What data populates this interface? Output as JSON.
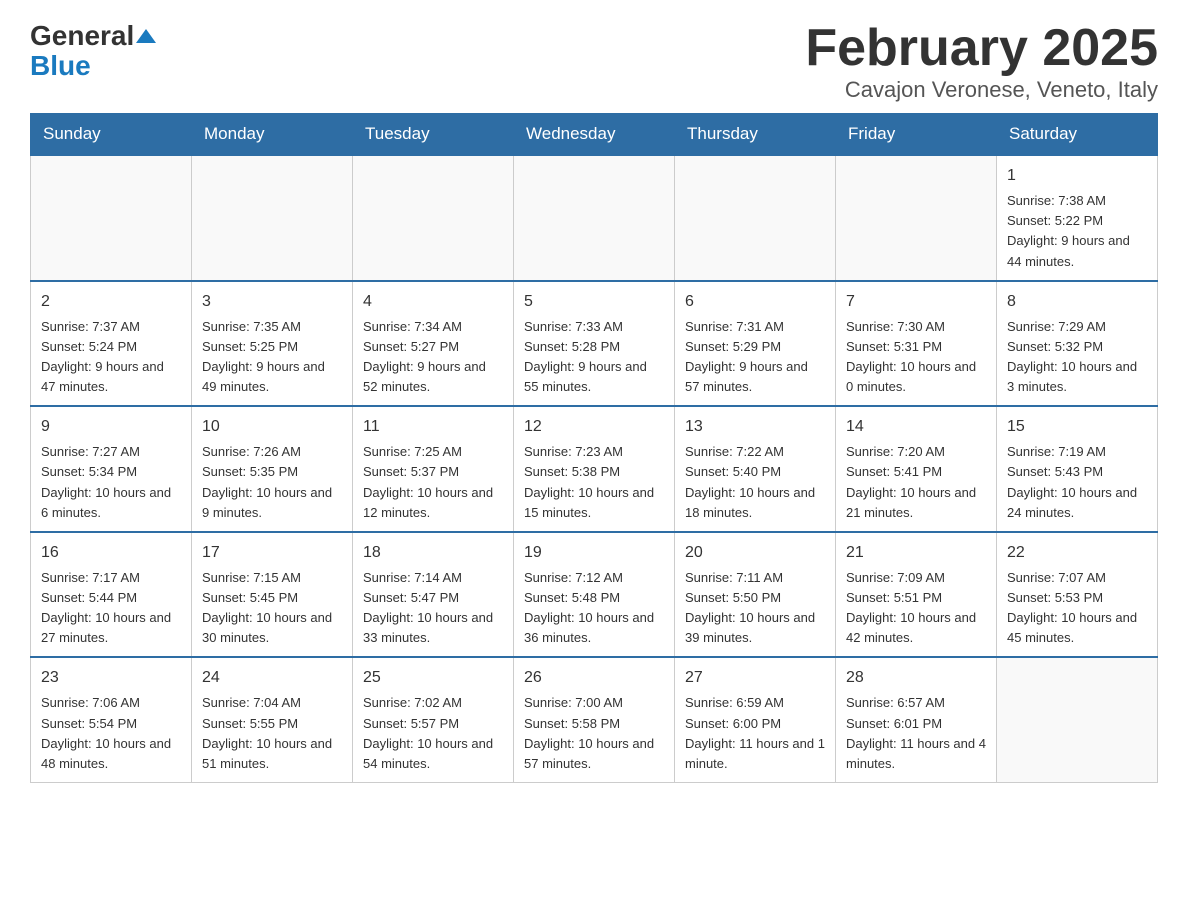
{
  "header": {
    "logo_general": "General",
    "logo_blue": "Blue",
    "month_title": "February 2025",
    "subtitle": "Cavajon Veronese, Veneto, Italy"
  },
  "days_of_week": [
    "Sunday",
    "Monday",
    "Tuesday",
    "Wednesday",
    "Thursday",
    "Friday",
    "Saturday"
  ],
  "weeks": [
    [
      {
        "day": "",
        "info": ""
      },
      {
        "day": "",
        "info": ""
      },
      {
        "day": "",
        "info": ""
      },
      {
        "day": "",
        "info": ""
      },
      {
        "day": "",
        "info": ""
      },
      {
        "day": "",
        "info": ""
      },
      {
        "day": "1",
        "info": "Sunrise: 7:38 AM\nSunset: 5:22 PM\nDaylight: 9 hours and 44 minutes."
      }
    ],
    [
      {
        "day": "2",
        "info": "Sunrise: 7:37 AM\nSunset: 5:24 PM\nDaylight: 9 hours and 47 minutes."
      },
      {
        "day": "3",
        "info": "Sunrise: 7:35 AM\nSunset: 5:25 PM\nDaylight: 9 hours and 49 minutes."
      },
      {
        "day": "4",
        "info": "Sunrise: 7:34 AM\nSunset: 5:27 PM\nDaylight: 9 hours and 52 minutes."
      },
      {
        "day": "5",
        "info": "Sunrise: 7:33 AM\nSunset: 5:28 PM\nDaylight: 9 hours and 55 minutes."
      },
      {
        "day": "6",
        "info": "Sunrise: 7:31 AM\nSunset: 5:29 PM\nDaylight: 9 hours and 57 minutes."
      },
      {
        "day": "7",
        "info": "Sunrise: 7:30 AM\nSunset: 5:31 PM\nDaylight: 10 hours and 0 minutes."
      },
      {
        "day": "8",
        "info": "Sunrise: 7:29 AM\nSunset: 5:32 PM\nDaylight: 10 hours and 3 minutes."
      }
    ],
    [
      {
        "day": "9",
        "info": "Sunrise: 7:27 AM\nSunset: 5:34 PM\nDaylight: 10 hours and 6 minutes."
      },
      {
        "day": "10",
        "info": "Sunrise: 7:26 AM\nSunset: 5:35 PM\nDaylight: 10 hours and 9 minutes."
      },
      {
        "day": "11",
        "info": "Sunrise: 7:25 AM\nSunset: 5:37 PM\nDaylight: 10 hours and 12 minutes."
      },
      {
        "day": "12",
        "info": "Sunrise: 7:23 AM\nSunset: 5:38 PM\nDaylight: 10 hours and 15 minutes."
      },
      {
        "day": "13",
        "info": "Sunrise: 7:22 AM\nSunset: 5:40 PM\nDaylight: 10 hours and 18 minutes."
      },
      {
        "day": "14",
        "info": "Sunrise: 7:20 AM\nSunset: 5:41 PM\nDaylight: 10 hours and 21 minutes."
      },
      {
        "day": "15",
        "info": "Sunrise: 7:19 AM\nSunset: 5:43 PM\nDaylight: 10 hours and 24 minutes."
      }
    ],
    [
      {
        "day": "16",
        "info": "Sunrise: 7:17 AM\nSunset: 5:44 PM\nDaylight: 10 hours and 27 minutes."
      },
      {
        "day": "17",
        "info": "Sunrise: 7:15 AM\nSunset: 5:45 PM\nDaylight: 10 hours and 30 minutes."
      },
      {
        "day": "18",
        "info": "Sunrise: 7:14 AM\nSunset: 5:47 PM\nDaylight: 10 hours and 33 minutes."
      },
      {
        "day": "19",
        "info": "Sunrise: 7:12 AM\nSunset: 5:48 PM\nDaylight: 10 hours and 36 minutes."
      },
      {
        "day": "20",
        "info": "Sunrise: 7:11 AM\nSunset: 5:50 PM\nDaylight: 10 hours and 39 minutes."
      },
      {
        "day": "21",
        "info": "Sunrise: 7:09 AM\nSunset: 5:51 PM\nDaylight: 10 hours and 42 minutes."
      },
      {
        "day": "22",
        "info": "Sunrise: 7:07 AM\nSunset: 5:53 PM\nDaylight: 10 hours and 45 minutes."
      }
    ],
    [
      {
        "day": "23",
        "info": "Sunrise: 7:06 AM\nSunset: 5:54 PM\nDaylight: 10 hours and 48 minutes."
      },
      {
        "day": "24",
        "info": "Sunrise: 7:04 AM\nSunset: 5:55 PM\nDaylight: 10 hours and 51 minutes."
      },
      {
        "day": "25",
        "info": "Sunrise: 7:02 AM\nSunset: 5:57 PM\nDaylight: 10 hours and 54 minutes."
      },
      {
        "day": "26",
        "info": "Sunrise: 7:00 AM\nSunset: 5:58 PM\nDaylight: 10 hours and 57 minutes."
      },
      {
        "day": "27",
        "info": "Sunrise: 6:59 AM\nSunset: 6:00 PM\nDaylight: 11 hours and 1 minute."
      },
      {
        "day": "28",
        "info": "Sunrise: 6:57 AM\nSunset: 6:01 PM\nDaylight: 11 hours and 4 minutes."
      },
      {
        "day": "",
        "info": ""
      }
    ]
  ]
}
